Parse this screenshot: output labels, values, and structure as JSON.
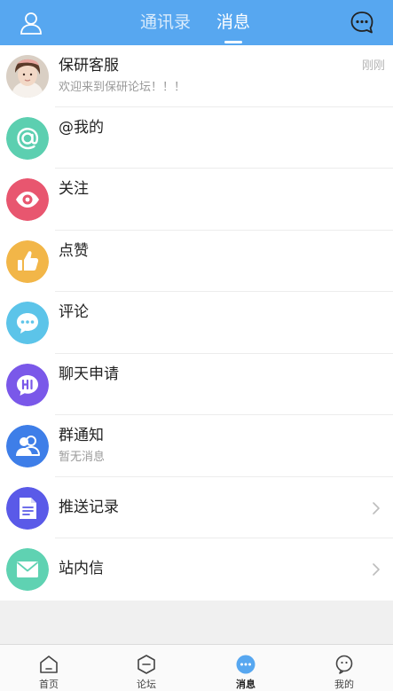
{
  "header": {
    "tabs": [
      {
        "label": "通讯录",
        "active": false
      },
      {
        "label": "消息",
        "active": true
      }
    ],
    "left_icon": "user-icon",
    "right_icon": "chat-bubble-icon",
    "background": "#57a7f0"
  },
  "rows": [
    {
      "title": "保研客服",
      "subtitle": "欢迎来到保研论坛！！！",
      "time": "刚刚",
      "icon": "avatar-photo"
    },
    {
      "title": "@我的",
      "icon": "at-icon",
      "color": "#5ccfb0"
    },
    {
      "title": "关注",
      "icon": "eye-icon",
      "color": "#e8566f"
    },
    {
      "title": "点赞",
      "icon": "thumbs-up-icon",
      "color": "#f2b648"
    },
    {
      "title": "评论",
      "icon": "comment-icon",
      "color": "#5cc4e9"
    },
    {
      "title": "聊天申请",
      "icon": "hi-bubble-icon",
      "color": "#7a58e9"
    },
    {
      "title": "群通知",
      "subtitle": "暂无消息",
      "icon": "group-icon",
      "color": "#3e7ee8"
    },
    {
      "title": "推送记录",
      "icon": "document-icon",
      "color": "#5a5ae8"
    },
    {
      "title": "站内信",
      "icon": "envelope-icon",
      "color": "#5fd2b2"
    }
  ],
  "tabbar": [
    {
      "label": "首页",
      "icon": "home-icon",
      "active": false
    },
    {
      "label": "论坛",
      "icon": "forum-icon",
      "active": false
    },
    {
      "label": "消息",
      "icon": "message-icon",
      "active": true
    },
    {
      "label": "我的",
      "icon": "profile-icon",
      "active": false
    }
  ]
}
